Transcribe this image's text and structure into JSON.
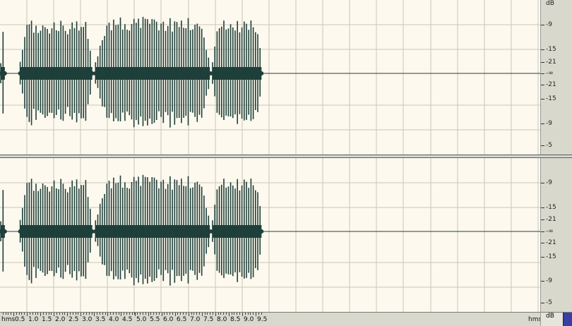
{
  "editor": {
    "time_ruler": {
      "unit_label": "hms",
      "end_label": "hms",
      "ticks": [
        "0.5",
        "1.0",
        "1.5",
        "2.0",
        "2.5",
        "3.0",
        "3.5",
        "4.0",
        "4.5",
        "5.0",
        "5.5",
        "6.0",
        "6.5",
        "7.0",
        "7.5",
        "8.0",
        "8.5",
        "9.0",
        "9.5"
      ]
    },
    "db_ruler": {
      "unit_label": "dB",
      "labels": [
        "-9",
        "-15",
        "-21",
        "-∞",
        "-21",
        "-15",
        "-9",
        "-5"
      ],
      "bottom_unit": "dB"
    },
    "colors": {
      "background": "#fdf9ee",
      "waveform": "#1f3f3a",
      "grid": "#c9c7b6",
      "ruler": "#d9d8cc",
      "splitter": "#4f5f6f"
    },
    "audio": {
      "channels": 2,
      "duration_s": 9.75,
      "segments": [
        {
          "start_s": 0.03,
          "end_s": 0.18,
          "level": 0.62
        },
        {
          "start_s": 0.75,
          "end_s": 3.43,
          "level": 0.78
        },
        {
          "start_s": 3.55,
          "end_s": 7.8,
          "level": 0.85
        },
        {
          "start_s": 7.9,
          "end_s": 9.72,
          "level": 0.82
        }
      ]
    }
  }
}
